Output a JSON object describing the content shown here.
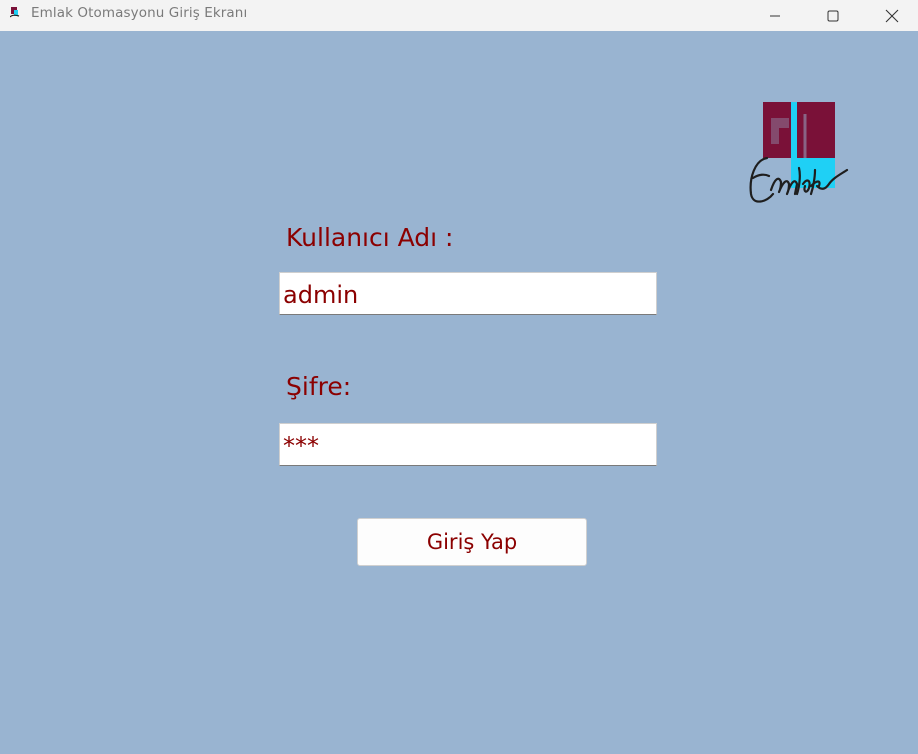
{
  "window": {
    "title": "Emlak Otomasyonu Giriş Ekranı",
    "controls": [
      "minimize",
      "maximize",
      "close"
    ]
  },
  "logo": {
    "text": "Emlak",
    "colors": {
      "maroon": "#7a1138",
      "cyan": "#1fd0f5",
      "script": "#1e1e1e"
    }
  },
  "form": {
    "username_label": "Kullanıcı Adı :",
    "username_value": "admin",
    "password_label": "Şifre:",
    "password_value": "***",
    "login_label": "Giriş Yap"
  },
  "colors": {
    "background": "#99b4d1",
    "text": "#8b0000",
    "titlebar": "#f3f3f3"
  }
}
